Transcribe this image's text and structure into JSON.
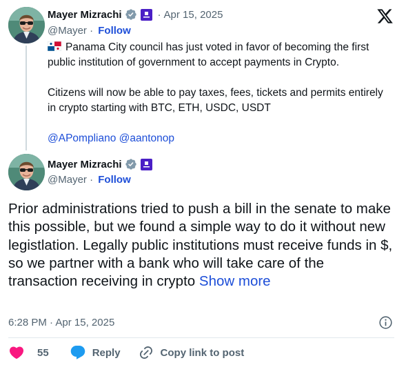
{
  "quoted_post": {
    "author_name": "Mayer Mizrachi",
    "date": "Apr 15, 2025",
    "handle": "@Mayer",
    "follow_label": "Follow",
    "text_line1": "Panama City council has just voted in favor of becoming the first public institution of government to accept payments in Crypto.",
    "text_line2": "Citizens will now be able to pay taxes, fees, tickets and permits entirely in crypto starting with BTC, ETH, USDC, USDT",
    "mention1": "@APompliano",
    "mention2": "@aantonop"
  },
  "main_post": {
    "author_name": "Mayer Mizrachi",
    "handle": "@Mayer",
    "follow_label": "Follow",
    "text": "Prior administrations tried to push a bill in the senate to make this possible, but we found a simple way to do it without new legistlation. Legally public institutions must receive funds in $, so we partner with a bank who will take care of the transaction receiving in crypto",
    "show_more_label": "Show more",
    "time": "6:28 PM",
    "date": "Apr 15, 2025"
  },
  "actions": {
    "like_count": "55",
    "reply_label": "Reply",
    "copy_label": "Copy link to post"
  },
  "icons": {
    "brand": "x-logo-icon",
    "verified": "verified-badge-icon",
    "like": "heart-icon",
    "reply": "speech-bubble-icon",
    "copy": "link-icon",
    "info": "info-icon",
    "flag": "panama-flag-icon"
  },
  "colors": {
    "link": "#1d4ed8",
    "verified": "#829aab",
    "like": "#f91880",
    "reply": "#1d9bf0",
    "muted": "#536471",
    "org_badge": "#4a1fc6"
  }
}
